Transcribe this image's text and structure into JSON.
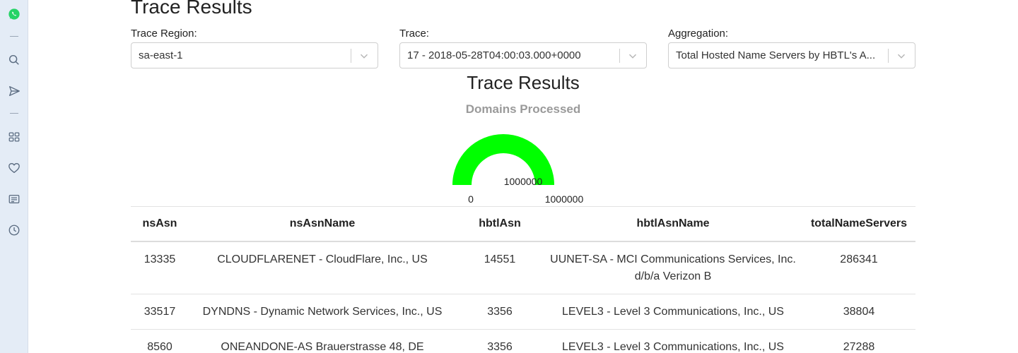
{
  "sidebar": {
    "items": [
      {
        "icon": "whatsapp-icon"
      },
      {
        "icon": "search-icon"
      },
      {
        "icon": "send-icon"
      },
      {
        "icon": "grid-icon"
      },
      {
        "icon": "heart-icon"
      },
      {
        "icon": "list-card-icon"
      },
      {
        "icon": "clock-icon"
      }
    ],
    "colors": {
      "whatsapp": "#25d366",
      "icon": "#5a6b80"
    }
  },
  "page": {
    "title": "Trace Results"
  },
  "filters": {
    "region": {
      "label": "Trace Region:",
      "value": "sa-east-1"
    },
    "trace": {
      "label": "Trace:",
      "value": "17 - 2018-05-28T04:00:03.000+0000"
    },
    "aggregation": {
      "label": "Aggregation:",
      "value": "Total Hosted Name Servers by HBTL's A..."
    }
  },
  "chart_data": {
    "type": "gauge",
    "title": "Trace Results",
    "subtitle": "Domains Processed",
    "value": 1000000,
    "value_label": "1000000",
    "min": 0,
    "max": 1000000,
    "min_label": "0",
    "max_label": "1000000",
    "color": "#00ff00"
  },
  "table": {
    "headers": [
      "nsAsn",
      "nsAsnName",
      "hbtlAsn",
      "hbtlAsnName",
      "totalNameServers"
    ],
    "rows": [
      [
        "13335",
        "CLOUDFLARENET - CloudFlare, Inc., US",
        "14551",
        "UUNET-SA - MCI Communications Services, Inc. d/b/a Verizon B",
        "286341"
      ],
      [
        "33517",
        "DYNDNS - Dynamic Network Services, Inc., US",
        "3356",
        "LEVEL3 - Level 3 Communications, Inc., US",
        "38804"
      ],
      [
        "8560",
        "ONEANDONE-AS Brauerstrasse 48, DE",
        "3356",
        "LEVEL3 - Level 3 Communications, Inc., US",
        "27288"
      ]
    ]
  }
}
